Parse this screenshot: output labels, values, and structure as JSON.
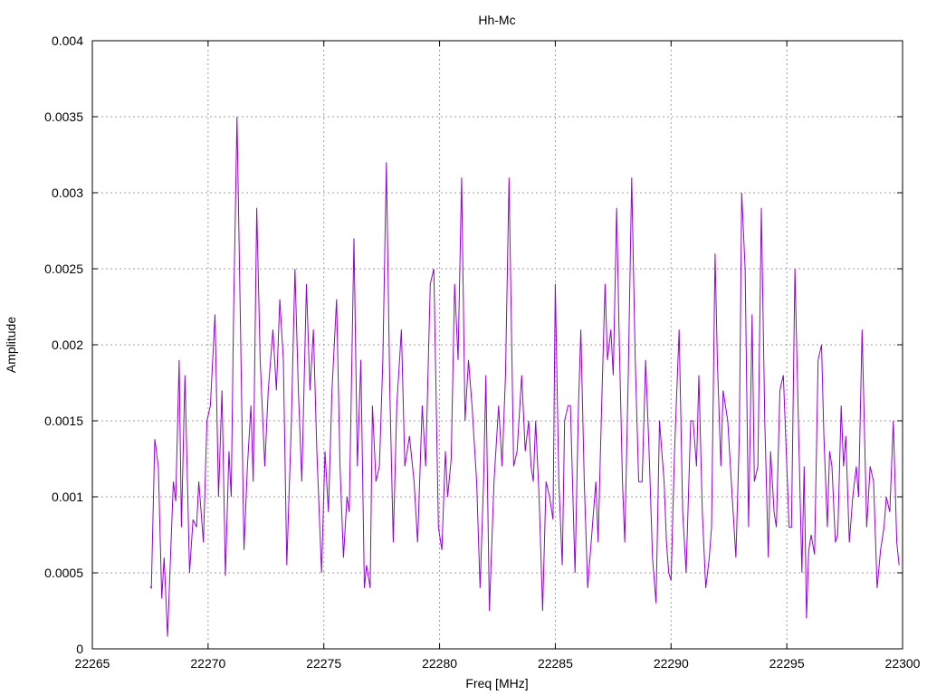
{
  "chart_data": {
    "type": "line",
    "title": "Hh-Mc",
    "xlabel": "Freq [MHz]",
    "ylabel": "Amplitude",
    "xlim": [
      22265,
      22300
    ],
    "ylim": [
      0,
      0.004
    ],
    "grid": true,
    "legend": "none",
    "xticks": [
      "22265",
      "22270",
      "22275",
      "22280",
      "22285",
      "22290",
      "22295",
      "22300"
    ],
    "yticks": [
      "0",
      "0.0005",
      "0.001",
      "0.0015",
      "0.002",
      "0.0025",
      "0.003",
      "0.0035",
      "0.004"
    ],
    "series": [
      {
        "name": "Hh-Mc",
        "color": "#9400d3",
        "points": [
          [
            22267.5,
            0.00041
          ],
          [
            22267.55,
            0.0004
          ],
          [
            22267.7,
            0.00138
          ],
          [
            22267.85,
            0.0012
          ],
          [
            22268.0,
            0.00033
          ],
          [
            22268.1,
            0.0006
          ],
          [
            22268.25,
            8e-05
          ],
          [
            22268.35,
            0.0005
          ],
          [
            22268.5,
            0.0011
          ],
          [
            22268.6,
            0.00097
          ],
          [
            22268.75,
            0.0019
          ],
          [
            22268.85,
            0.0008
          ],
          [
            22269.0,
            0.0018
          ],
          [
            22269.2,
            0.0005
          ],
          [
            22269.35,
            0.00085
          ],
          [
            22269.5,
            0.0008
          ],
          [
            22269.6,
            0.0011
          ],
          [
            22269.8,
            0.0007
          ],
          [
            22269.95,
            0.0015
          ],
          [
            22270.1,
            0.0016
          ],
          [
            22270.3,
            0.0022
          ],
          [
            22270.45,
            0.001
          ],
          [
            22270.6,
            0.0017
          ],
          [
            22270.75,
            0.00048
          ],
          [
            22270.9,
            0.0013
          ],
          [
            22271.0,
            0.001
          ],
          [
            22271.1,
            0.0022
          ],
          [
            22271.25,
            0.0035
          ],
          [
            22271.4,
            0.0021
          ],
          [
            22271.55,
            0.00065
          ],
          [
            22271.7,
            0.0012
          ],
          [
            22271.85,
            0.0016
          ],
          [
            22271.95,
            0.0011
          ],
          [
            22272.1,
            0.0029
          ],
          [
            22272.25,
            0.0019
          ],
          [
            22272.45,
            0.0012
          ],
          [
            22272.6,
            0.0017
          ],
          [
            22272.8,
            0.0021
          ],
          [
            22272.95,
            0.0017
          ],
          [
            22273.1,
            0.0023
          ],
          [
            22273.25,
            0.0019
          ],
          [
            22273.4,
            0.00055
          ],
          [
            22273.6,
            0.0015
          ],
          [
            22273.75,
            0.0025
          ],
          [
            22273.9,
            0.0017
          ],
          [
            22274.05,
            0.0011
          ],
          [
            22274.25,
            0.0024
          ],
          [
            22274.4,
            0.0017
          ],
          [
            22274.55,
            0.0021
          ],
          [
            22274.7,
            0.0013
          ],
          [
            22274.9,
            0.0005
          ],
          [
            22275.05,
            0.0013
          ],
          [
            22275.2,
            0.0009
          ],
          [
            22275.35,
            0.0017
          ],
          [
            22275.55,
            0.0023
          ],
          [
            22275.7,
            0.0012
          ],
          [
            22275.85,
            0.0006
          ],
          [
            22276.0,
            0.001
          ],
          [
            22276.1,
            0.0009
          ],
          [
            22276.3,
            0.0027
          ],
          [
            22276.45,
            0.0012
          ],
          [
            22276.6,
            0.0019
          ],
          [
            22276.75,
            0.0004
          ],
          [
            22276.85,
            0.00055
          ],
          [
            22277.0,
            0.0004
          ],
          [
            22277.1,
            0.0016
          ],
          [
            22277.25,
            0.0011
          ],
          [
            22277.4,
            0.0012
          ],
          [
            22277.55,
            0.0019
          ],
          [
            22277.7,
            0.0032
          ],
          [
            22277.85,
            0.0017
          ],
          [
            22278.0,
            0.0007
          ],
          [
            22278.15,
            0.0016
          ],
          [
            22278.35,
            0.0021
          ],
          [
            22278.5,
            0.0012
          ],
          [
            22278.7,
            0.0014
          ],
          [
            22278.9,
            0.0011
          ],
          [
            22279.05,
            0.0007
          ],
          [
            22279.25,
            0.0016
          ],
          [
            22279.4,
            0.0012
          ],
          [
            22279.6,
            0.0024
          ],
          [
            22279.75,
            0.0025
          ],
          [
            22279.95,
            0.0008
          ],
          [
            22280.1,
            0.00065
          ],
          [
            22280.25,
            0.0013
          ],
          [
            22280.35,
            0.001
          ],
          [
            22280.5,
            0.00125
          ],
          [
            22280.65,
            0.0024
          ],
          [
            22280.8,
            0.0019
          ],
          [
            22280.95,
            0.0031
          ],
          [
            22281.1,
            0.0015
          ],
          [
            22281.25,
            0.0019
          ],
          [
            22281.4,
            0.0016
          ],
          [
            22281.6,
            0.0011
          ],
          [
            22281.75,
            0.0004
          ],
          [
            22281.9,
            0.0011
          ],
          [
            22282.0,
            0.0018
          ],
          [
            22282.15,
            0.00025
          ],
          [
            22282.35,
            0.0011
          ],
          [
            22282.55,
            0.0016
          ],
          [
            22282.7,
            0.0012
          ],
          [
            22282.85,
            0.0018
          ],
          [
            22283.0,
            0.0031
          ],
          [
            22283.2,
            0.0012
          ],
          [
            22283.35,
            0.0013
          ],
          [
            22283.55,
            0.0018
          ],
          [
            22283.7,
            0.0013
          ],
          [
            22283.85,
            0.0015
          ],
          [
            22283.95,
            0.0012
          ],
          [
            22284.05,
            0.0011
          ],
          [
            22284.15,
            0.0015
          ],
          [
            22284.3,
            0.001
          ],
          [
            22284.45,
            0.00025
          ],
          [
            22284.6,
            0.0011
          ],
          [
            22284.75,
            0.001
          ],
          [
            22284.9,
            0.00085
          ],
          [
            22285.0,
            0.0024
          ],
          [
            22285.15,
            0.0011
          ],
          [
            22285.3,
            0.00055
          ],
          [
            22285.4,
            0.0015
          ],
          [
            22285.55,
            0.0016
          ],
          [
            22285.65,
            0.0016
          ],
          [
            22285.85,
            0.0005
          ],
          [
            22286.0,
            0.0016
          ],
          [
            22286.1,
            0.0021
          ],
          [
            22286.25,
            0.0011
          ],
          [
            22286.4,
            0.0004
          ],
          [
            22286.6,
            0.0008
          ],
          [
            22286.75,
            0.0011
          ],
          [
            22286.85,
            0.0007
          ],
          [
            22287.0,
            0.0016
          ],
          [
            22287.15,
            0.0024
          ],
          [
            22287.25,
            0.0019
          ],
          [
            22287.4,
            0.0021
          ],
          [
            22287.5,
            0.0018
          ],
          [
            22287.65,
            0.0029
          ],
          [
            22287.75,
            0.0021
          ],
          [
            22287.9,
            0.0011
          ],
          [
            22288.0,
            0.0007
          ],
          [
            22288.15,
            0.0018
          ],
          [
            22288.3,
            0.0031
          ],
          [
            22288.45,
            0.0019
          ],
          [
            22288.6,
            0.0011
          ],
          [
            22288.75,
            0.0011
          ],
          [
            22288.9,
            0.0019
          ],
          [
            22289.05,
            0.0013
          ],
          [
            22289.2,
            0.0006
          ],
          [
            22289.35,
            0.0003
          ],
          [
            22289.5,
            0.0015
          ],
          [
            22289.7,
            0.0011
          ],
          [
            22289.8,
            0.0007
          ],
          [
            22289.9,
            0.0005
          ],
          [
            22290.0,
            0.00045
          ],
          [
            22290.15,
            0.0013
          ],
          [
            22290.35,
            0.0021
          ],
          [
            22290.5,
            0.0009
          ],
          [
            22290.65,
            0.0005
          ],
          [
            22290.85,
            0.0015
          ],
          [
            22290.95,
            0.0015
          ],
          [
            22291.1,
            0.0012
          ],
          [
            22291.2,
            0.0018
          ],
          [
            22291.35,
            0.0009
          ],
          [
            22291.5,
            0.0004
          ],
          [
            22291.65,
            0.0006
          ],
          [
            22291.75,
            0.0008
          ],
          [
            22291.9,
            0.0026
          ],
          [
            22292.0,
            0.0019
          ],
          [
            22292.15,
            0.0012
          ],
          [
            22292.25,
            0.0017
          ],
          [
            22292.45,
            0.0015
          ],
          [
            22292.6,
            0.0011
          ],
          [
            22292.8,
            0.0006
          ],
          [
            22292.95,
            0.0014
          ],
          [
            22293.05,
            0.003
          ],
          [
            22293.2,
            0.0025
          ],
          [
            22293.35,
            0.0008
          ],
          [
            22293.5,
            0.0022
          ],
          [
            22293.6,
            0.0011
          ],
          [
            22293.75,
            0.0012
          ],
          [
            22293.9,
            0.0029
          ],
          [
            22294.05,
            0.0015
          ],
          [
            22294.2,
            0.0006
          ],
          [
            22294.3,
            0.0013
          ],
          [
            22294.45,
            0.0009
          ],
          [
            22294.55,
            0.0008
          ],
          [
            22294.7,
            0.0017
          ],
          [
            22294.85,
            0.0018
          ],
          [
            22294.95,
            0.0014
          ],
          [
            22295.1,
            0.0008
          ],
          [
            22295.2,
            0.0008
          ],
          [
            22295.35,
            0.0025
          ],
          [
            22295.5,
            0.0015
          ],
          [
            22295.65,
            0.0005
          ],
          [
            22295.75,
            0.0012
          ],
          [
            22295.85,
            0.0002
          ],
          [
            22295.95,
            0.00065
          ],
          [
            22296.05,
            0.00075
          ],
          [
            22296.2,
            0.00062
          ],
          [
            22296.35,
            0.0019
          ],
          [
            22296.5,
            0.002
          ],
          [
            22296.6,
            0.0014
          ],
          [
            22296.75,
            0.0008
          ],
          [
            22296.85,
            0.0013
          ],
          [
            22296.95,
            0.0012
          ],
          [
            22297.1,
            0.0007
          ],
          [
            22297.2,
            0.00075
          ],
          [
            22297.35,
            0.0016
          ],
          [
            22297.45,
            0.0012
          ],
          [
            22297.55,
            0.0014
          ],
          [
            22297.7,
            0.0007
          ],
          [
            22297.85,
            0.001
          ],
          [
            22298.0,
            0.0012
          ],
          [
            22298.1,
            0.001
          ],
          [
            22298.25,
            0.0021
          ],
          [
            22298.45,
            0.0008
          ],
          [
            22298.6,
            0.0012
          ],
          [
            22298.75,
            0.0011
          ],
          [
            22298.9,
            0.0004
          ],
          [
            22299.05,
            0.00065
          ],
          [
            22299.2,
            0.0008
          ],
          [
            22299.3,
            0.001
          ],
          [
            22299.45,
            0.0009
          ],
          [
            22299.6,
            0.0015
          ],
          [
            22299.75,
            0.0007
          ],
          [
            22299.85,
            0.00055
          ]
        ]
      }
    ]
  }
}
